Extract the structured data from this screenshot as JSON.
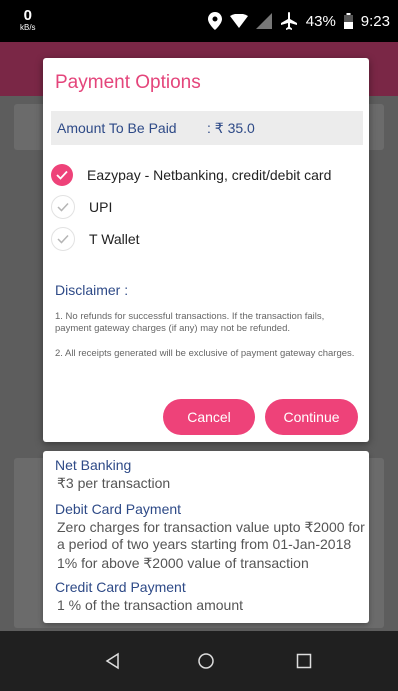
{
  "status_bar": {
    "net_speed_value": "0",
    "net_speed_unit": "kB/s",
    "battery_percent": "43%",
    "time": "9:23"
  },
  "dialog": {
    "title": "Payment Options",
    "amount_label": "Amount To Be Paid",
    "amount_value": ": ₹ 35.0",
    "options": [
      {
        "label": "Eazypay - Netbanking, credit/debit card",
        "selected": true
      },
      {
        "label": "UPI",
        "selected": false
      },
      {
        "label": "T Wallet",
        "selected": false
      }
    ],
    "disclaimer_title": "Disclaimer :",
    "disclaimer_1": "1. No refunds for successful transactions. If the transaction fails, payment gateway charges (if any) may not be refunded.",
    "disclaimer_2": "2. All receipts generated will be exclusive of payment gateway charges.",
    "cancel_label": "Cancel",
    "continue_label": "Continue"
  },
  "charges": {
    "netbanking_title": "Net Banking",
    "netbanking_text": "₹3 per transaction",
    "debit_title": "Debit Card Payment",
    "debit_line1": "Zero charges for transaction value upto ₹2000 for a period of two years starting from 01-Jan-2018",
    "debit_line2": "1% for above ₹2000 value of transaction",
    "credit_title": "Credit Card Payment",
    "credit_text": "1 % of the transaction amount"
  },
  "colors": {
    "accent": "#ee4279",
    "title_pink": "#e4457b",
    "label_blue": "#2e4a87"
  },
  "icons": [
    "location-icon",
    "wifi-icon",
    "no-signal-icon",
    "airplane-icon",
    "battery-icon",
    "check-icon",
    "back-icon",
    "home-icon",
    "recents-icon"
  ]
}
